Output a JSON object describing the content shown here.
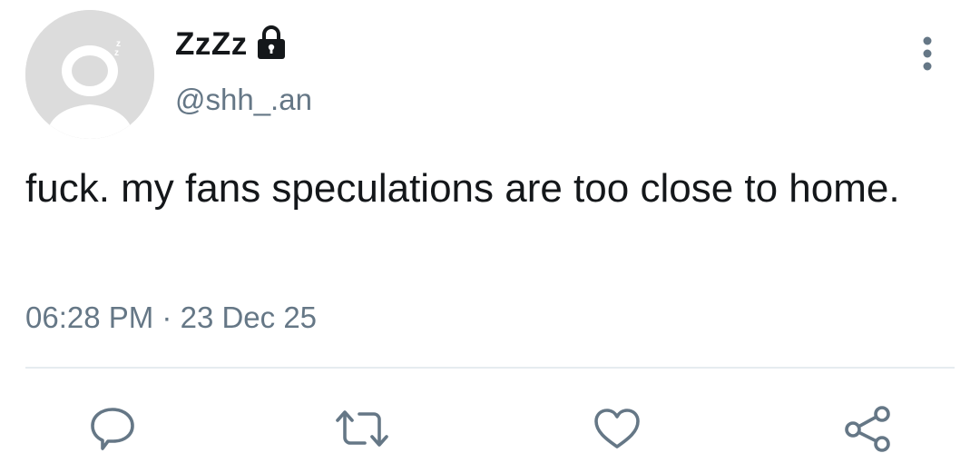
{
  "user": {
    "display_name": "ZzZz",
    "handle": "@shh_.an",
    "avatar_icon": "default-avatar-icon",
    "protected_icon": "lock-icon"
  },
  "tweet": {
    "text": "fuck. my fans speculations are too close to home.",
    "time": "06:28 PM",
    "separator": "·",
    "date": "23 Dec 25"
  },
  "actions": [
    {
      "name": "reply",
      "icon": "reply-icon"
    },
    {
      "name": "retweet",
      "icon": "retweet-icon"
    },
    {
      "name": "like",
      "icon": "heart-icon"
    },
    {
      "name": "share",
      "icon": "share-icon"
    }
  ],
  "colors": {
    "text": "#14171a",
    "secondary": "#657786",
    "divider": "#e6ecf0",
    "avatar_bg": "#dcdcdc"
  }
}
